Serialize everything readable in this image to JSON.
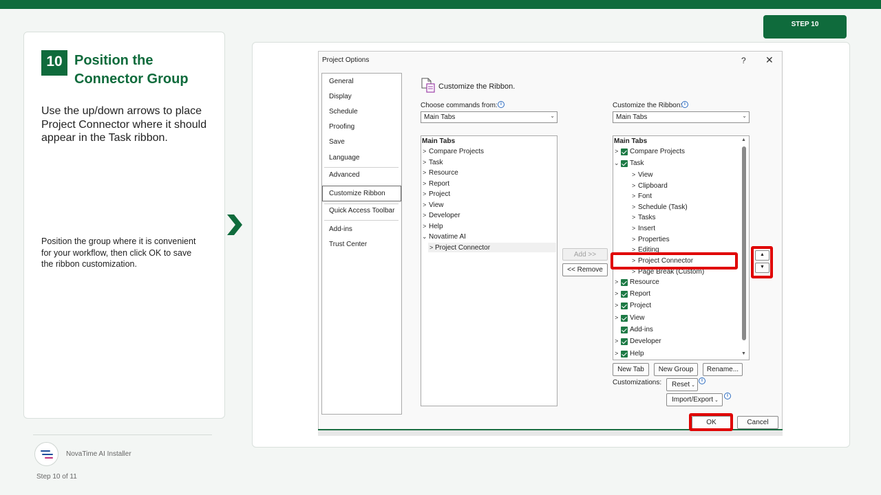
{
  "header": {
    "step_badge": "STEP 10"
  },
  "instruction": {
    "number": "10",
    "title": "Position the Connector Group",
    "description": "Use the up/down arrows to place Project Connector where it should appear in the Task ribbon.",
    "note": "Position the group where it is convenient for your workflow, then click OK to save the ribbon customization."
  },
  "footer": {
    "brand": "NovaTime AI Installer",
    "progress": "Step 10 of 11"
  },
  "dialog": {
    "title": "Project Options",
    "help": "?",
    "close": "✕",
    "nav": [
      "General",
      "Display",
      "Schedule",
      "Proofing",
      "Save",
      "Language",
      "Advanced",
      "Customize Ribbon",
      "Quick Access Toolbar",
      "Add-ins",
      "Trust Center"
    ],
    "nav_selected": "Customize Ribbon",
    "section_heading": "Customize the Ribbon.",
    "choose_label": "Choose commands from:",
    "choose_value": "Main Tabs",
    "customize_label": "Customize the Ribbon:",
    "customize_value": "Main Tabs",
    "left_list": {
      "header": "Main Tabs",
      "items": [
        "Compare Projects",
        "Task",
        "Resource",
        "Report",
        "Project",
        "View",
        "Developer",
        "Help",
        "Novatime AI"
      ],
      "child": "Project Connector"
    },
    "right_list": {
      "header": "Main Tabs",
      "top_items": [
        "Compare Projects",
        "Task"
      ],
      "task_groups": [
        "View",
        "Clipboard",
        "Font",
        "Schedule (Task)",
        "Tasks",
        "Insert",
        "Properties",
        "Editing",
        "Project Connector",
        "Page Break (Custom)"
      ],
      "bottom_items": [
        "Resource",
        "Report",
        "Project",
        "View",
        "Add-ins",
        "Developer",
        "Help"
      ]
    },
    "add_button": "Add >>",
    "remove_button": "<< Remove",
    "new_tab": "New Tab",
    "new_group": "New Group",
    "rename": "Rename...",
    "customizations_label": "Customizations:",
    "reset": "Reset",
    "import_export": "Import/Export",
    "ok": "OK",
    "cancel": "Cancel"
  },
  "colors": {
    "brand_green": "#0f6b3c",
    "highlight_red": "#e00000"
  }
}
